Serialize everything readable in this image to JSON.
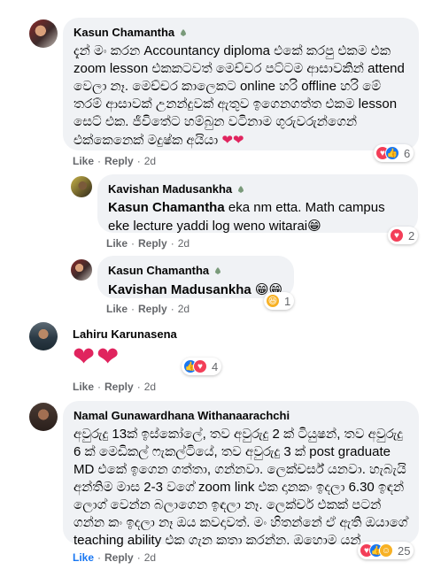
{
  "comments": [
    {
      "author": "Kasun Chamantha",
      "text": "දැන් මං කරන Accountancy diploma එකේ කරපු එකම එක zoom lesson එකකටවත් මෙච්චර පට්ටම ආසාවකින් attend වෙලා නෑ. මෙච්චර කාලෙකට online හරි offline හරි මේ තරම් ආසාවක් උනන්දුවක් ඇතුව ඉගෙනගත්ත එකම lesson සෙට් එක. ජීවිතේට හම්බුන වටිනාම ගුරුවරුන්ගෙන් එක්කෙනෙක් මදුෂ්ක අයියා",
      "emoji": "❤❤",
      "like": "Like",
      "reply": "Reply",
      "time": "2d",
      "reaction_count": "6"
    },
    {
      "author": "Kavishan Madusankha",
      "mention": "Kasun Chamantha",
      "text": " eka nm etta. Math campus eke lecture yaddi log weno witarai",
      "emoji": "😁",
      "like": "Like",
      "reply": "Reply",
      "time": "2d",
      "reaction_count": "2"
    },
    {
      "author": "Kasun Chamantha",
      "mention": "Kavishan Madusankha",
      "emoji": "😁😁",
      "like": "Like",
      "reply": "Reply",
      "time": "2d",
      "reaction_count": "1"
    },
    {
      "author": "Lahiru Karunasena",
      "emoji": "❤❤",
      "like": "Like",
      "reply": "Reply",
      "time": "2d",
      "reaction_count": "4"
    },
    {
      "author": "Namal Gunawardhana Withanaarachchi",
      "text": "අවුරුදු 13ක් ඉස්කෝලේ, තව අවුරුදු 2 ක් ටියුෂන්, තව අවුරුදු 6 ක් මෙඩිකල් ෆැකල්ටියේ, තව අවුරුදු 3 ක් post graduate MD එකේ ඉගෙන ගත්තා, ගන්නවා. ලෙක්චර්ස් යනවා. හැබැයි අන්තිම මාස 2-3 වගේ zoom link එක දානකං ඉදලා 6.30 ඉඳන් ලොග් වෙන්න බලාගෙන ඉඳලා නෑ. ලෙක්චර් එකක් පටන් ගන්න කං ඉදලා නෑ ඔය කවදාවත්. මං හිතන්නේ ඒ ඇති ඔයාගේ teaching ability එක ගැන කතා කරන්න. ඔහොම යන්.....",
      "like": "Like",
      "reply": "Reply",
      "time": "2d",
      "reaction_count": "25"
    }
  ]
}
